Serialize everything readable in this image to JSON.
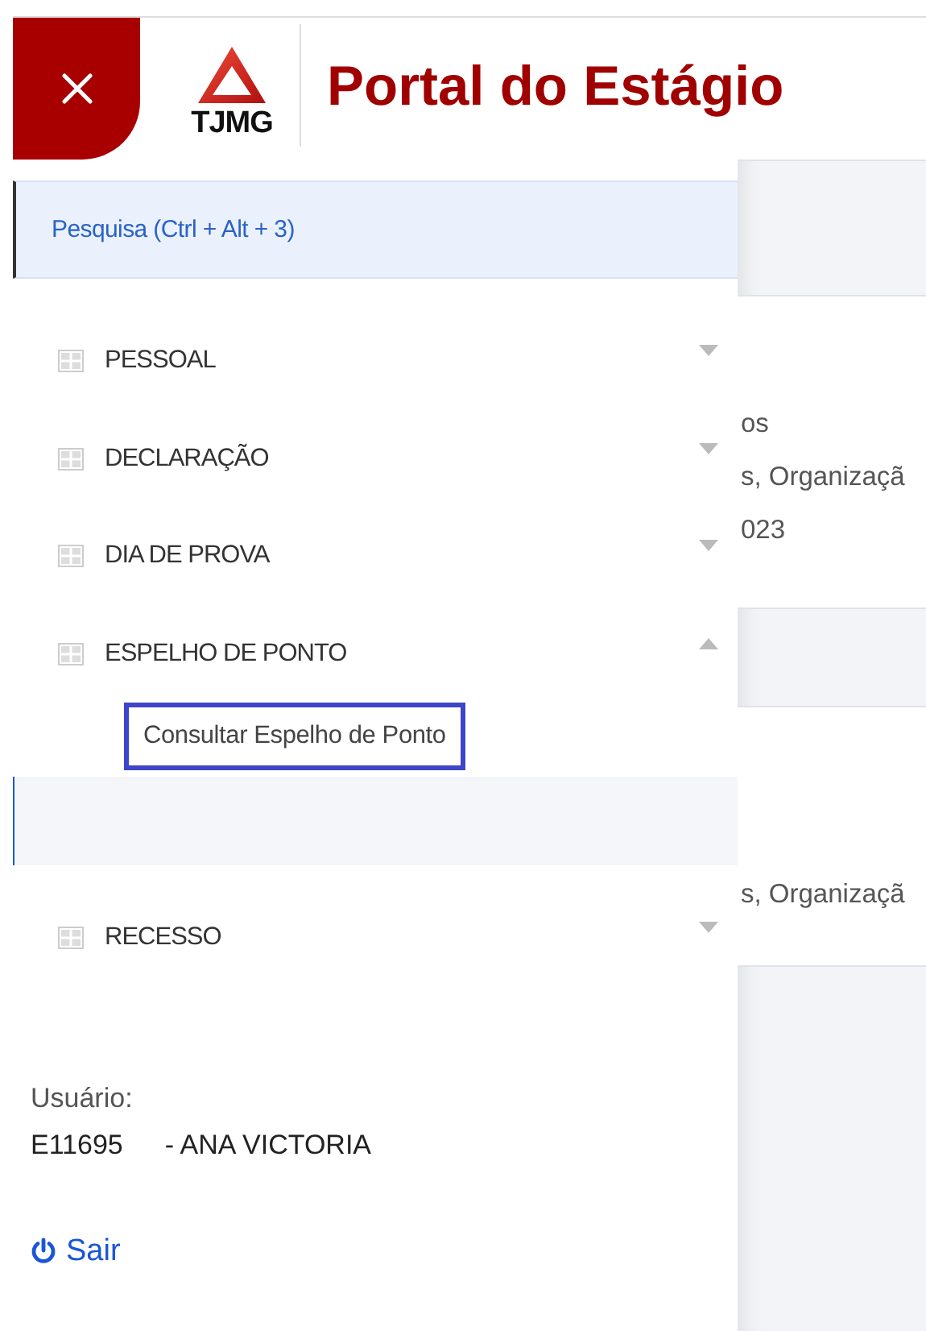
{
  "header": {
    "logo_text": "TJMG",
    "title": "Portal do Estágio"
  },
  "search": {
    "label": "Pesquisa (Ctrl + Alt + 3)"
  },
  "menu": [
    {
      "label": "PESSOAL",
      "expanded": false
    },
    {
      "label": "DECLARAÇÃO",
      "expanded": false
    },
    {
      "label": "DIA DE PROVA",
      "expanded": false
    },
    {
      "label": "ESPELHO DE PONTO",
      "expanded": true,
      "children": [
        {
          "label": "Consultar Espelho de Ponto",
          "selected": true
        }
      ]
    },
    {
      "label": "RECESSO",
      "expanded": false
    }
  ],
  "user": {
    "label": "Usuário:",
    "id": "E11695",
    "name": "- ANA VICTORIA"
  },
  "logout": {
    "label": "Sair"
  },
  "background": {
    "cards": [
      {
        "lines": [
          "os",
          "s, Organizaçã",
          "023"
        ]
      },
      {
        "lines": [
          "s, Organizaçã"
        ]
      }
    ]
  }
}
